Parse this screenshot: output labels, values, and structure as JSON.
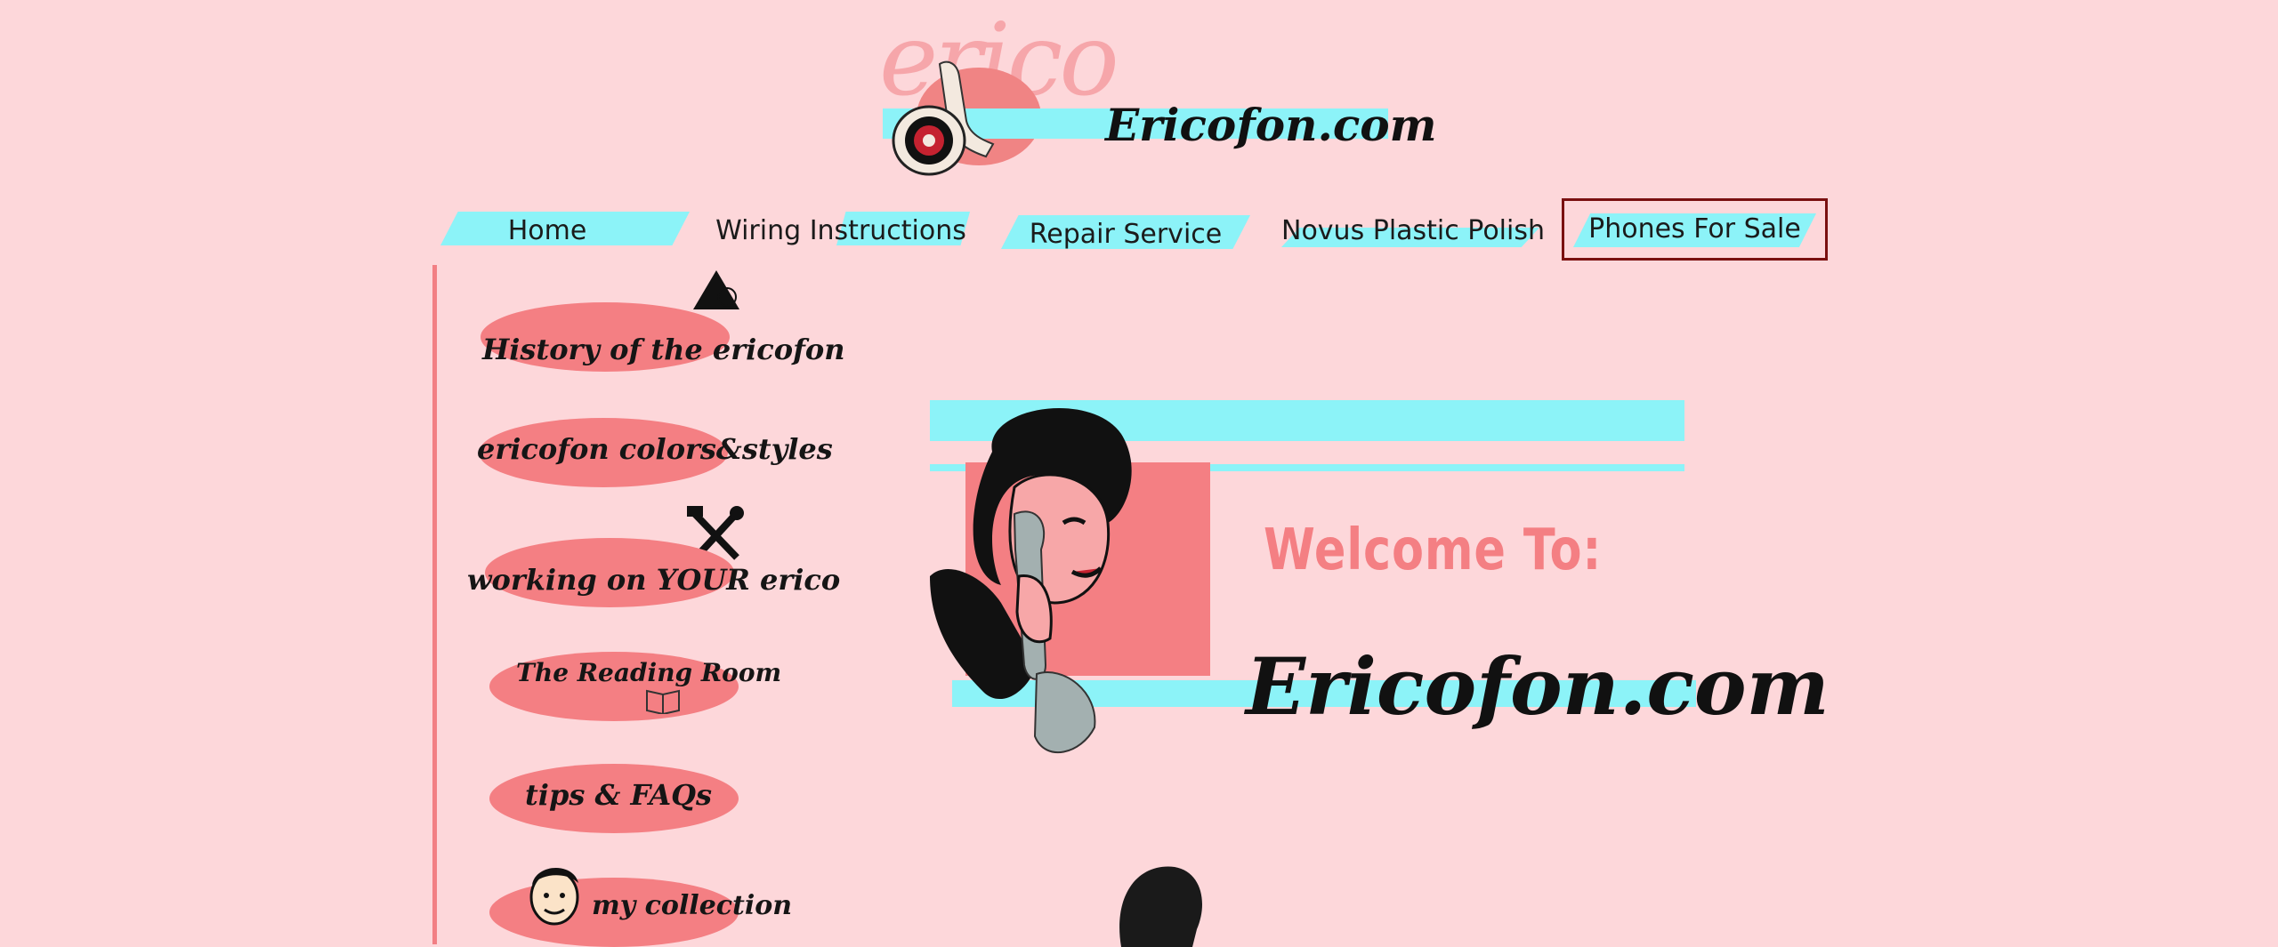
{
  "header": {
    "logo_ghost": "erico",
    "logo_text": "Ericofon.com"
  },
  "nav": [
    {
      "label": "Home",
      "active": false
    },
    {
      "label": "Wiring Instructions",
      "active": false
    },
    {
      "label": "Repair Service",
      "active": false
    },
    {
      "label": "Novus Plastic Polish",
      "active": false
    },
    {
      "label": "Phones For Sale",
      "active": true
    }
  ],
  "sidebar": {
    "items": [
      {
        "label": "History of the ericofon",
        "icon": "triangle-icon"
      },
      {
        "label": "ericofon colors&styles",
        "icon": ""
      },
      {
        "label": "working on YOUR erico",
        "icon": "tools-icon"
      },
      {
        "label": "The Reading Room",
        "icon": "book-icon"
      },
      {
        "label": "tips & FAQs",
        "icon": ""
      },
      {
        "label": "my collection",
        "icon": "face-icon"
      }
    ]
  },
  "hero": {
    "welcome": "Welcome To:",
    "brand": "Ericofon.com"
  },
  "colors": {
    "background": "#fdd7da",
    "accent_cyan": "#8cf3f8",
    "accent_salmon": "#f47f83",
    "active_outline": "#7a1010"
  }
}
